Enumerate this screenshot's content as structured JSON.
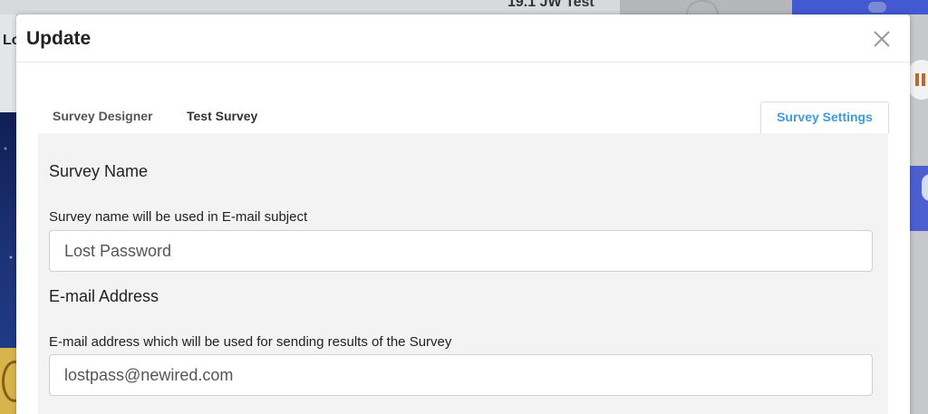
{
  "background": {
    "title": "19.1 JW Test",
    "left_text": "Lo"
  },
  "modal": {
    "title": "Update",
    "close_icon": "close-icon"
  },
  "tabs": [
    {
      "label": "Survey Designer"
    },
    {
      "label": "Test Survey"
    },
    {
      "label": "Survey Settings",
      "active": true
    }
  ],
  "fields": {
    "survey_name": {
      "title": "Survey Name",
      "help": "Survey name will be used in E-mail subject",
      "value": "Lost Password"
    },
    "email": {
      "title": "E-mail Address",
      "help": "E-mail address which will be used for sending results of the Survey",
      "value": "lostpass@newired.com"
    }
  },
  "colors": {
    "accent": "#3f9be0",
    "panel": "#f3f3f3"
  }
}
